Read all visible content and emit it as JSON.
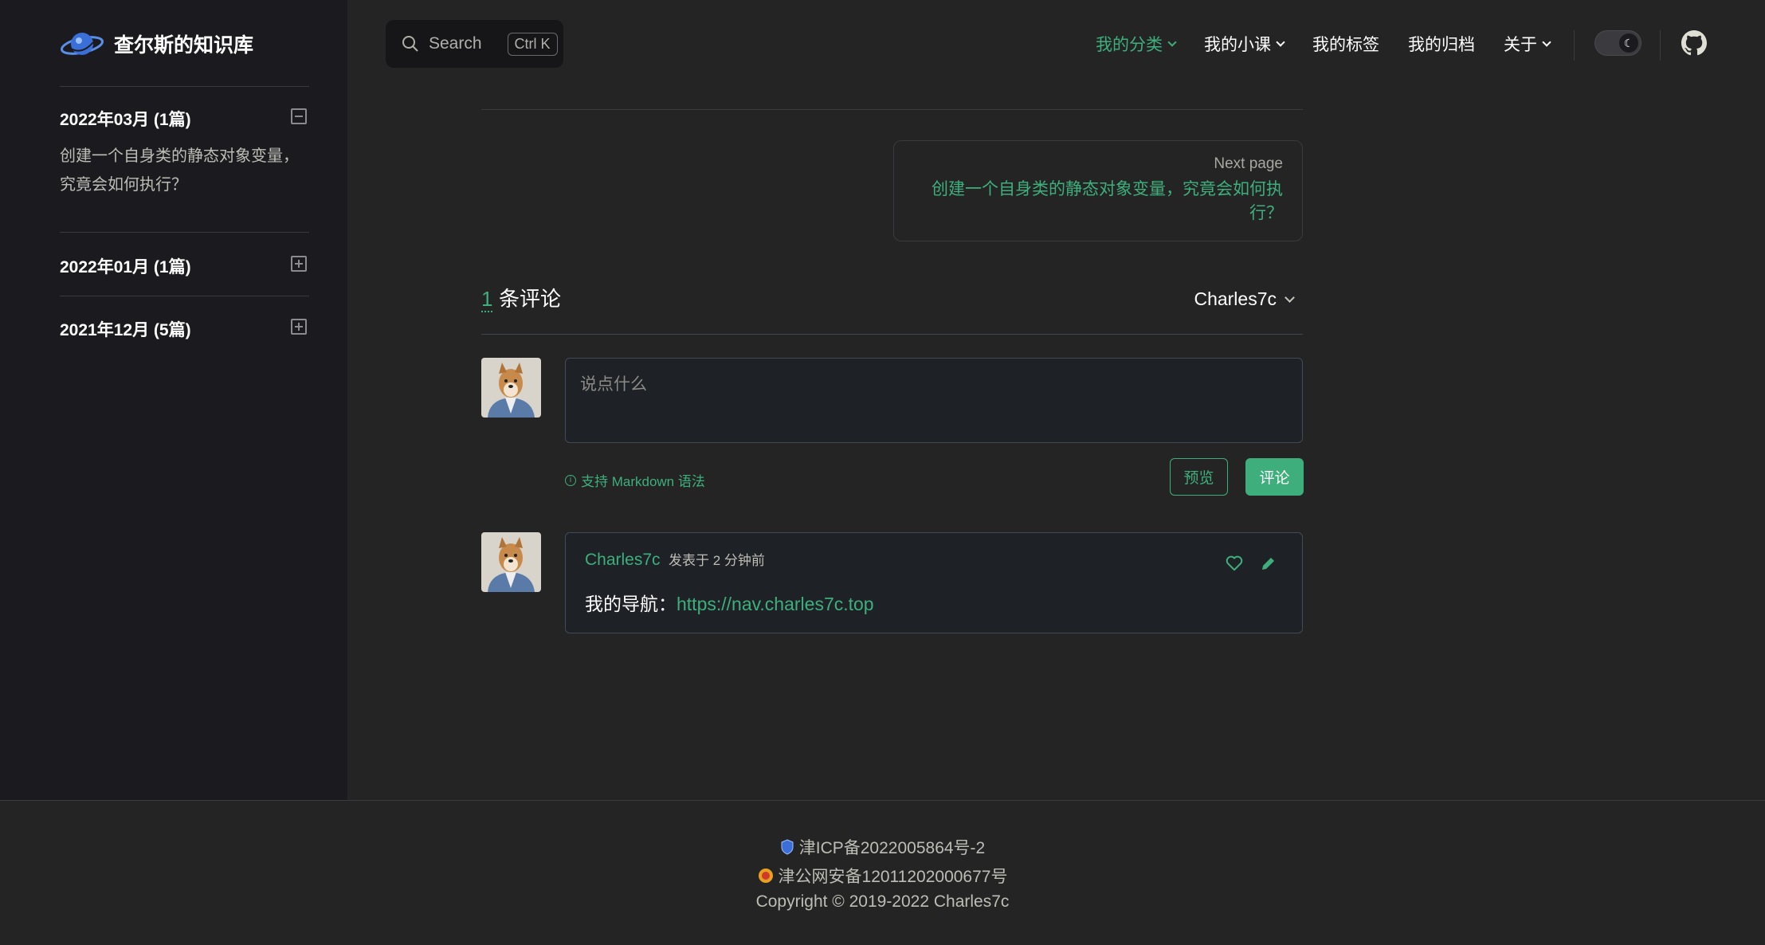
{
  "brand": {
    "name": "查尔斯的知识库",
    "logo_icon": "planet-logo-icon"
  },
  "sidebar": {
    "groups": [
      {
        "title": "2022年03月 (1篇)",
        "expanded": true,
        "posts": [
          "创建一个自身类的静态对象变量，究竟会如何执行？"
        ]
      },
      {
        "title": "2022年01月 (1篇)",
        "expanded": false,
        "posts": []
      },
      {
        "title": "2021年12月 (5篇)",
        "expanded": false,
        "posts": []
      }
    ]
  },
  "search": {
    "label": "Search",
    "shortcut": "Ctrl K"
  },
  "nav": {
    "items": [
      {
        "label": "我的分类",
        "dropdown": true,
        "active": true
      },
      {
        "label": "我的小课",
        "dropdown": true,
        "active": false
      },
      {
        "label": "我的标签",
        "dropdown": false,
        "active": false
      },
      {
        "label": "我的归档",
        "dropdown": false,
        "active": false
      },
      {
        "label": "关于",
        "dropdown": true,
        "active": false
      }
    ]
  },
  "pager": {
    "next_label": "Next page",
    "next_title": "创建一个自身类的静态对象变量，究竟会如何执行？"
  },
  "comments": {
    "count": "1",
    "count_label": "条评论",
    "current_user": "Charles7c",
    "placeholder": "说点什么",
    "markdown_hint": "支持 Markdown 语法",
    "preview_label": "预览",
    "submit_label": "评论",
    "items": [
      {
        "author": "Charles7c",
        "meta": "发表于  2 分钟前",
        "body_prefix": "我的导航：",
        "body_link": "https://nav.charles7c.top"
      }
    ]
  },
  "footer": {
    "icp": "津ICP备2022005864号-2",
    "police": "津公网安备12011202000677号",
    "copyright": "Copyright © 2019-2022 Charles7c"
  },
  "colors": {
    "accent": "#3eaf7c",
    "bg": "#242424",
    "sidebar_bg": "#1b1b1f"
  }
}
